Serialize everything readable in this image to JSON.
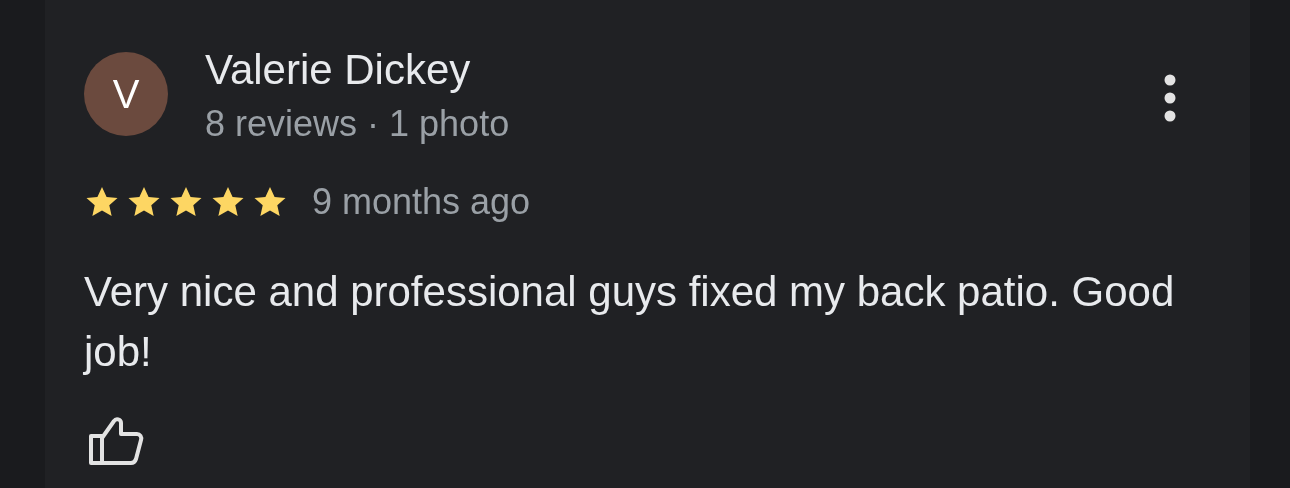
{
  "review": {
    "avatar_letter": "V",
    "author": "Valerie Dickey",
    "author_meta": "8 reviews · 1 photo",
    "stars": 5,
    "time": "9 months ago",
    "text": "Very nice and professional guys fixed my back patio. Good job!"
  }
}
